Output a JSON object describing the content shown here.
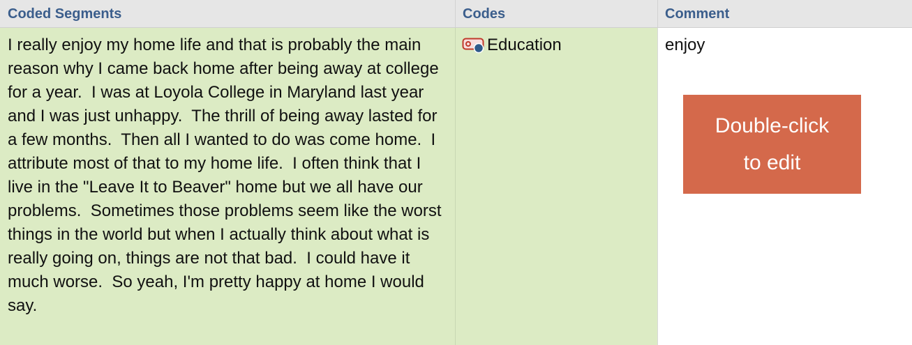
{
  "table": {
    "columns": [
      {
        "label": "Coded Segments"
      },
      {
        "label": "Codes"
      },
      {
        "label": "Comment"
      }
    ],
    "rows": [
      {
        "segment": "I really enjoy my home life and that is probably the main reason why I came back home after being away at college for a year.  I was at Loyola College in Maryland last year and I was just unhappy.  The thrill of being away lasted for a few months.  Then all I wanted to do was come home.  I attribute most of that to my home life.  I often think that I live in the \"Leave It to Beaver\" home but we all have our problems.  Sometimes those problems seem like the worst things in the world but when I actually think about what is really going on, things are not that bad.  I could have it much worse.  So yeah, I'm pretty happy at home I would say.",
        "code": {
          "label": "Education",
          "icon": "code-tag-icon",
          "icon_color": "#c0392b",
          "dot_color": "#2f5a8a"
        },
        "comment": "enjoy"
      }
    ]
  },
  "edit_hint": {
    "line1": "Double-click",
    "line2": "to edit",
    "color": "#d4694b"
  },
  "colors": {
    "header_text": "#3b5e8c",
    "segment_bg": "#dcebc4",
    "header_bg": "#e6e6e6"
  }
}
